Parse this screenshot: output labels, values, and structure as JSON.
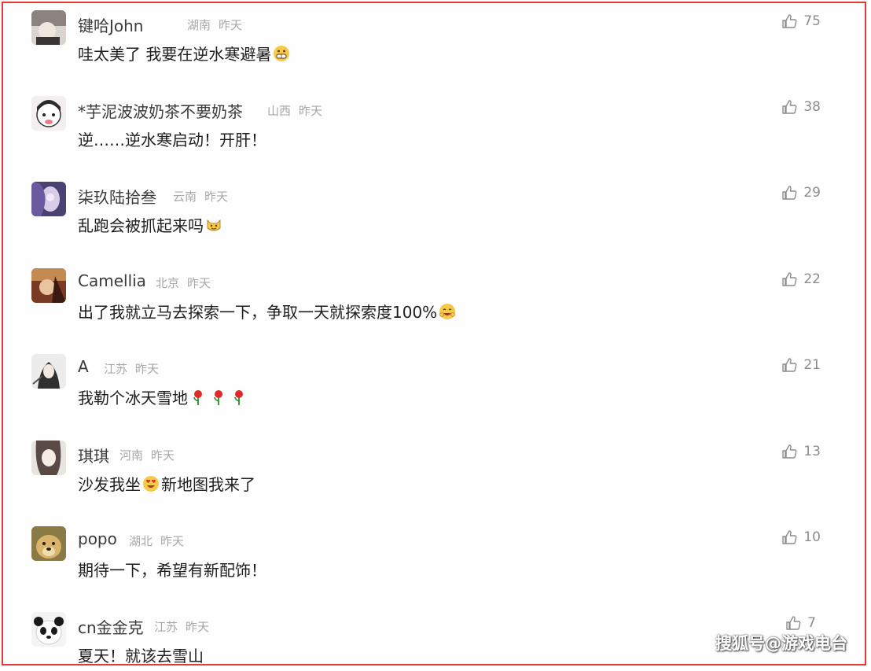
{
  "comments": [
    {
      "username": "键哈John",
      "region": "湖南",
      "time": "昨天",
      "text": "哇太美了 我要在逆水寒避暑",
      "emoji": "grin-emoji",
      "likes": "75"
    },
    {
      "username": "*芋泥波波奶茶不要奶茶",
      "region": "山西",
      "time": "昨天",
      "text": "逆……逆水寒启动！开肝！",
      "emoji": "",
      "likes": "38"
    },
    {
      "username": "柒玖陆拾叁",
      "region": "云南",
      "time": "昨天",
      "text": "乱跑会被抓起来吗",
      "emoji": "cat-emoji",
      "likes": "29"
    },
    {
      "username": "Camellia",
      "region": "北京",
      "time": "昨天",
      "text": "出了我就立马去探索一下，争取一天就探索度100%",
      "emoji": "happy-emoji",
      "likes": "22"
    },
    {
      "username": "A",
      "region": "江苏",
      "time": "昨天",
      "text": "我勒个冰天雪地",
      "emoji": "rose-emoji",
      "likes": "21"
    },
    {
      "username": "琪琪",
      "region": "河南",
      "time": "昨天",
      "text_a": "沙发我坐",
      "text_b": "新地图我来了",
      "emoji": "heart-eyes-emoji",
      "likes": "13"
    },
    {
      "username": "popo",
      "region": "湖北",
      "time": "昨天",
      "text": "期待一下，希望有新配饰！",
      "emoji": "",
      "likes": "10"
    },
    {
      "username": "cn金金克",
      "region": "江苏",
      "time": "昨天",
      "text": "夏天！就该去雪山",
      "emoji": "",
      "likes": "7"
    }
  ],
  "watermark": "搜狐号@游戏电台",
  "colors": {
    "border": "#e23a3a",
    "meta": "#a8a8a8",
    "text": "#1e1e1e"
  }
}
